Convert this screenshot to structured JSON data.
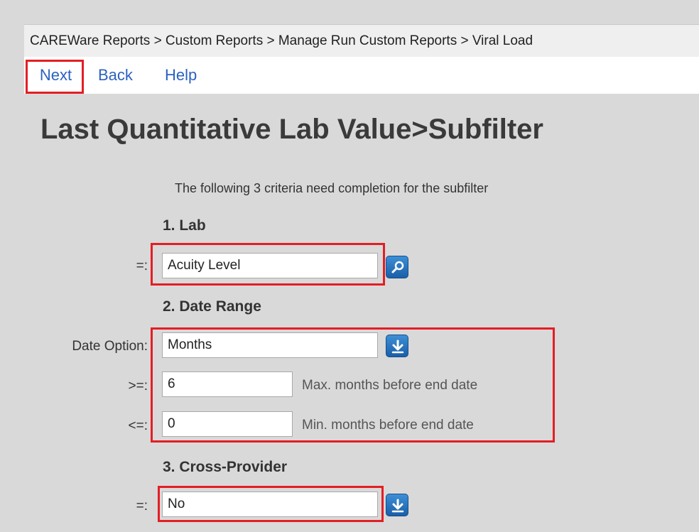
{
  "breadcrumb": "CAREWare Reports > Custom Reports > Manage Run Custom Reports > Viral Load",
  "nav": {
    "next": "Next",
    "back": "Back",
    "help": "Help"
  },
  "page_title": "Last Quantitative Lab Value>Subfilter",
  "criteria_text": "The following 3 criteria need completion for the subfilter",
  "lab": {
    "heading": "1. Lab",
    "operator": "=:",
    "value": "Acuity Level",
    "icon": "search-icon"
  },
  "date_range": {
    "heading": "2. Date Range",
    "option_label": "Date Option:",
    "option_value": "Months",
    "option_icon": "dropdown-arrow-icon",
    "max_operator": ">=:",
    "max_value": "6",
    "max_hint": "Max. months before end date",
    "min_operator": "<=:",
    "min_value": "0",
    "min_hint": "Min. months before end date"
  },
  "cross_provider": {
    "heading": "3. Cross-Provider",
    "operator": "=:",
    "value": "No",
    "icon": "dropdown-arrow-icon"
  },
  "colors": {
    "highlight": "#e31e24",
    "link": "#2b62c0",
    "button": "#1a5fa8"
  }
}
